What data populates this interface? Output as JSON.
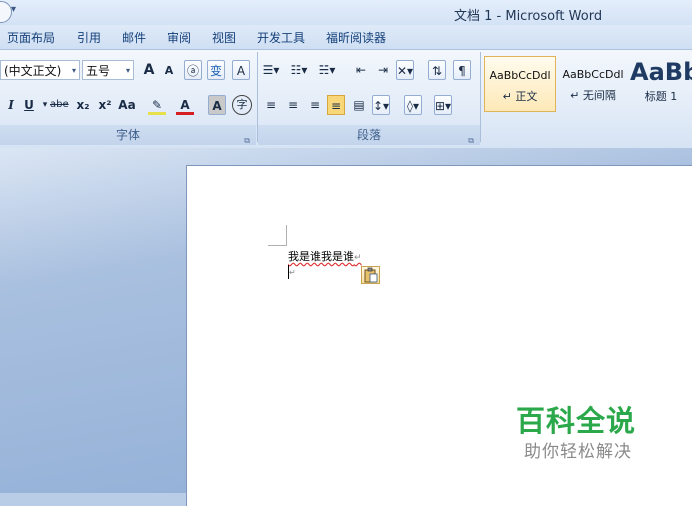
{
  "window": {
    "title": "文档 1 - Microsoft Word"
  },
  "tabs": [
    "页面布局",
    "引用",
    "邮件",
    "审阅",
    "视图",
    "开发工具",
    "福昕阅读器"
  ],
  "ribbon": {
    "font_group": {
      "label": "字体",
      "font_name": "(中文正文)",
      "font_size": "五号",
      "grow_font": "A",
      "shrink_font": "A",
      "phonetic": "变",
      "char_border": "A",
      "italic": "I",
      "underline": "U",
      "strikethrough": "abe",
      "subscript": "x₂",
      "superscript": "x²",
      "change_case": "Aa",
      "font_color": "A",
      "char_shading": "A",
      "enclose": "字"
    },
    "paragraph_group": {
      "label": "段落"
    },
    "styles": [
      {
        "sample": "AaBbCcDdl",
        "name": "正文",
        "selected": true
      },
      {
        "sample": "AaBbCcDdl",
        "name": "无间隔",
        "selected": false
      },
      {
        "sample": "AaBb",
        "name": "标题 1",
        "selected": false
      }
    ]
  },
  "document": {
    "line1": "我是谁我是谁",
    "para_mark": "↵"
  },
  "watermark": {
    "title": "百科全说",
    "subtitle": "助你轻松解决"
  },
  "colors": {
    "accent": "#2aa84a",
    "ribbon": "#dfe9f6",
    "workspace": "#9fb8dc"
  }
}
